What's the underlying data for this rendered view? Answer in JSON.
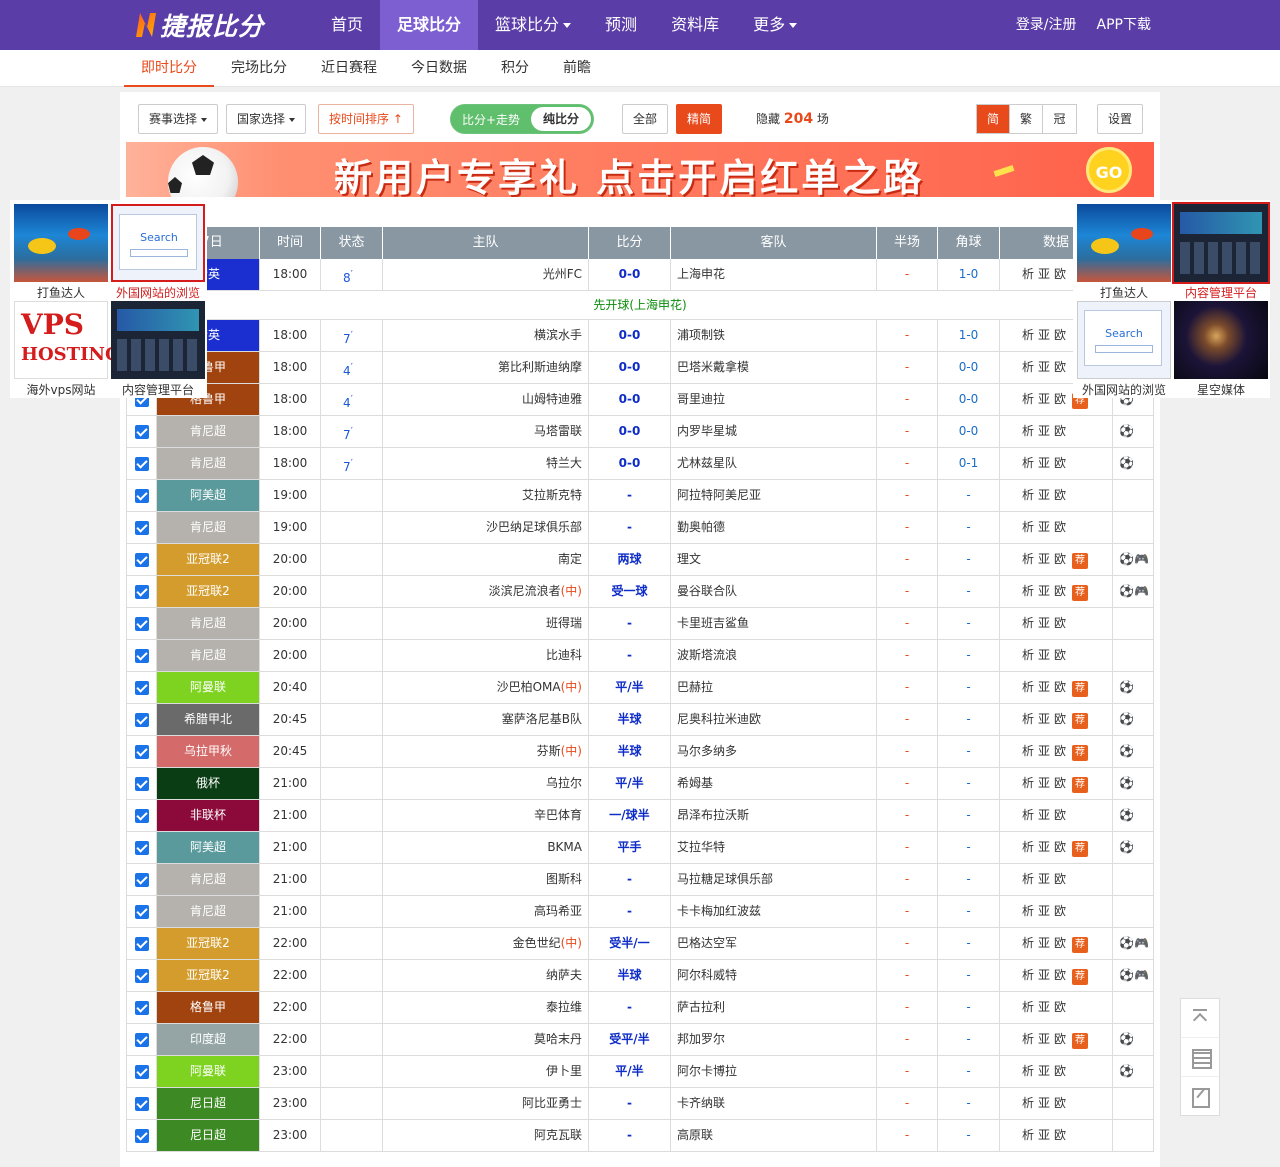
{
  "nav": {
    "logo": "捷报比分",
    "items": [
      {
        "label": "首页",
        "active": false,
        "caret": false
      },
      {
        "label": "足球比分",
        "active": true,
        "caret": false
      },
      {
        "label": "篮球比分",
        "active": false,
        "caret": true
      },
      {
        "label": "预测",
        "active": false,
        "caret": false
      },
      {
        "label": "资料库",
        "active": false,
        "caret": false
      },
      {
        "label": "更多",
        "active": false,
        "caret": true
      }
    ],
    "login": "登录/注册",
    "app": "APP下载"
  },
  "subnav": [
    "即时比分",
    "完场比分",
    "近日赛程",
    "今日数据",
    "积分",
    "前瞻"
  ],
  "filter": {
    "event_select": "赛事选择",
    "country_select": "国家选择",
    "sort_time": "按时间排序",
    "sort_arrow": "↑",
    "mode_trend": "比分+走势",
    "mode_pure": "纯比分",
    "all": "全部",
    "featured": "精简",
    "hidden_prefix": "隐藏",
    "hidden_count": "204",
    "hidden_suffix": "场",
    "lang": [
      "简",
      "繁",
      "冠"
    ],
    "settings": "设置"
  },
  "banner": {
    "text": "新用户专享礼 点击开启红单之路",
    "go": "GO"
  },
  "table": {
    "headers": [
      "",
      "27日",
      "时间",
      "状态",
      "主队",
      "比分",
      "客队",
      "半场",
      "角球",
      "数据",
      ""
    ],
    "data_links": [
      "析",
      "亚",
      "欧"
    ],
    "recommend": "荐",
    "notice": "先开球(上海申花)",
    "rows": [
      {
        "league": "精英",
        "color": "#1b2fd1",
        "time": "18:00",
        "status": "8",
        "home": "光州FC",
        "score": "0-0",
        "away": "上海申花",
        "half": "-",
        "corner": "1-0",
        "rec": false,
        "icons": ""
      },
      {
        "league": "精英",
        "color": "#1b2fd1",
        "time": "18:00",
        "status": "7",
        "home": "横滨水手",
        "score": "0-0",
        "away": "浦项制铁",
        "half": "-",
        "corner": "1-0",
        "rec": false,
        "icons": ""
      },
      {
        "league": "格鲁甲",
        "color": "#a0430e",
        "time": "18:00",
        "status": "4",
        "home": "第比利斯迪纳摩",
        "score": "0-0",
        "away": "巴塔米戴拿模",
        "half": "-",
        "corner": "0-0",
        "rec": false,
        "icons": ""
      },
      {
        "league": "格鲁甲",
        "color": "#a0430e",
        "time": "18:00",
        "status": "4",
        "home": "山姆特迪雅",
        "score": "0-0",
        "away": "哥里迪拉",
        "half": "-",
        "corner": "0-0",
        "rec": true,
        "icons": "⚽"
      },
      {
        "league": "肯尼超",
        "color": "#b5b1ad",
        "time": "18:00",
        "status": "7",
        "home": "马塔雷联",
        "score": "0-0",
        "away": "内罗毕星城",
        "half": "-",
        "corner": "0-0",
        "rec": false,
        "icons": "⚽"
      },
      {
        "league": "肯尼超",
        "color": "#b5b1ad",
        "time": "18:00",
        "status": "7",
        "home": "特兰大",
        "score": "0-0",
        "away": "尤林兹星队",
        "half": "-",
        "corner": "0-1",
        "rec": false,
        "icons": "⚽"
      },
      {
        "league": "阿美超",
        "color": "#5a9a9c",
        "time": "19:00",
        "status": "",
        "home": "艾拉斯克特",
        "score": "-",
        "away": "阿拉特阿美尼亚",
        "half": "-",
        "corner": "-",
        "rec": false,
        "icons": ""
      },
      {
        "league": "肯尼超",
        "color": "#b5b1ad",
        "time": "19:00",
        "status": "",
        "home": "沙巴纳足球俱乐部",
        "score": "-",
        "away": "勤奥帕德",
        "half": "-",
        "corner": "-",
        "rec": false,
        "icons": ""
      },
      {
        "league": "亚冠联2",
        "color": "#d49c2c",
        "time": "20:00",
        "status": "",
        "home": "南定",
        "score": "两球",
        "away": "理文",
        "half": "-",
        "corner": "-",
        "rec": true,
        "icons": "⚽🎮"
      },
      {
        "league": "亚冠联2",
        "color": "#d49c2c",
        "time": "20:00",
        "status": "",
        "home": "淡滨尼流浪者",
        "homeTag": "(中)",
        "score": "受一球",
        "away": "曼谷联合队",
        "half": "-",
        "corner": "-",
        "rec": true,
        "icons": "⚽🎮"
      },
      {
        "league": "肯尼超",
        "color": "#b5b1ad",
        "time": "20:00",
        "status": "",
        "home": "班得瑞",
        "score": "-",
        "away": "卡里班吉鲨鱼",
        "half": "-",
        "corner": "-",
        "rec": false,
        "icons": ""
      },
      {
        "league": "肯尼超",
        "color": "#b5b1ad",
        "time": "20:00",
        "status": "",
        "home": "比迪科",
        "score": "-",
        "away": "波斯塔流浪",
        "half": "-",
        "corner": "-",
        "rec": false,
        "icons": ""
      },
      {
        "league": "阿曼联",
        "color": "#7ed321",
        "time": "20:40",
        "status": "",
        "home": "沙巴柏OMA",
        "homeTag": "(中)",
        "score": "平/半",
        "away": "巴赫拉",
        "half": "-",
        "corner": "-",
        "rec": true,
        "icons": "⚽"
      },
      {
        "league": "希腊甲北",
        "color": "#6a6a6a",
        "time": "20:45",
        "status": "",
        "home": "塞萨洛尼基B队",
        "score": "半球",
        "away": "尼奥科拉米迪欧",
        "half": "-",
        "corner": "-",
        "rec": true,
        "icons": "⚽"
      },
      {
        "league": "乌拉甲秋",
        "color": "#d46a6a",
        "time": "20:45",
        "status": "",
        "home": "芬斯",
        "homeTag": "(中)",
        "score": "半球",
        "away": "马尔多纳多",
        "half": "-",
        "corner": "-",
        "rec": true,
        "icons": "⚽"
      },
      {
        "league": "俄杯",
        "color": "#0a3d14",
        "time": "21:00",
        "status": "",
        "home": "乌拉尔",
        "score": "平/半",
        "away": "希姆基",
        "half": "-",
        "corner": "-",
        "rec": true,
        "icons": "⚽"
      },
      {
        "league": "非联杯",
        "color": "#8c0a3a",
        "time": "21:00",
        "status": "",
        "home": "辛巴体育",
        "score": "一/球半",
        "away": "昂泽布拉沃斯",
        "half": "-",
        "corner": "-",
        "rec": false,
        "icons": "⚽"
      },
      {
        "league": "阿美超",
        "color": "#5a9a9c",
        "time": "21:00",
        "status": "",
        "home": "BKMA",
        "score": "平手",
        "away": "艾拉华特",
        "half": "-",
        "corner": "-",
        "rec": true,
        "icons": "⚽"
      },
      {
        "league": "肯尼超",
        "color": "#b5b1ad",
        "time": "21:00",
        "status": "",
        "home": "图斯科",
        "score": "-",
        "away": "马拉糖足球俱乐部",
        "half": "-",
        "corner": "-",
        "rec": false,
        "icons": ""
      },
      {
        "league": "肯尼超",
        "color": "#b5b1ad",
        "time": "21:00",
        "status": "",
        "home": "高玛希亚",
        "score": "-",
        "away": "卡卡梅加红波兹",
        "half": "-",
        "corner": "-",
        "rec": false,
        "icons": ""
      },
      {
        "league": "亚冠联2",
        "color": "#d49c2c",
        "time": "22:00",
        "status": "",
        "home": "金色世纪",
        "homeTag": "(中)",
        "score": "受半/一",
        "away": "巴格达空军",
        "half": "-",
        "corner": "-",
        "rec": true,
        "icons": "⚽🎮"
      },
      {
        "league": "亚冠联2",
        "color": "#d49c2c",
        "time": "22:00",
        "status": "",
        "home": "纳萨夫",
        "score": "半球",
        "away": "阿尔科威特",
        "half": "-",
        "corner": "-",
        "rec": true,
        "icons": "⚽🎮"
      },
      {
        "league": "格鲁甲",
        "color": "#a0430e",
        "time": "22:00",
        "status": "",
        "home": "泰拉维",
        "score": "-",
        "away": "萨古拉利",
        "half": "-",
        "corner": "-",
        "rec": false,
        "icons": ""
      },
      {
        "league": "印度超",
        "color": "#95a5a6",
        "time": "22:00",
        "status": "",
        "home": "莫哈末丹",
        "score": "受平/半",
        "away": "邦加罗尔",
        "half": "-",
        "corner": "-",
        "rec": true,
        "icons": "⚽"
      },
      {
        "league": "阿曼联",
        "color": "#7ed321",
        "time": "23:00",
        "status": "",
        "home": "伊卜里",
        "score": "平/半",
        "away": "阿尔卡博拉",
        "half": "-",
        "corner": "-",
        "rec": false,
        "icons": "⚽"
      },
      {
        "league": "尼日超",
        "color": "#3d8a24",
        "time": "23:00",
        "status": "",
        "home": "阿比亚勇士",
        "score": "-",
        "away": "卡齐纳联",
        "half": "-",
        "corner": "-",
        "rec": false,
        "icons": ""
      },
      {
        "league": "尼日超",
        "color": "#3d8a24",
        "time": "23:00",
        "status": "",
        "home": "阿克瓦联",
        "score": "-",
        "away": "高原联",
        "half": "-",
        "corner": "-",
        "rec": false,
        "icons": ""
      }
    ]
  },
  "ads": {
    "left": [
      {
        "label": "打鱼达人",
        "img": "fish"
      },
      {
        "label": "外国网站的浏览",
        "img": "search",
        "red": true
      },
      {
        "label": "海外vps网站",
        "img": "vps"
      },
      {
        "label": "内容管理平台",
        "img": "dash"
      }
    ],
    "right": [
      {
        "label": "打鱼达人",
        "img": "fish"
      },
      {
        "label": "内容管理平台",
        "img": "dash",
        "red": true
      },
      {
        "label": "外国网站的浏览",
        "img": "search"
      },
      {
        "label": "星空媒体",
        "img": "stars"
      }
    ],
    "search_word": "Search",
    "vps_top": "VPS",
    "vps_bottom": "HOSTING"
  },
  "tools": [
    "back-to-top-icon",
    "qr-code-icon",
    "feedback-icon"
  ]
}
